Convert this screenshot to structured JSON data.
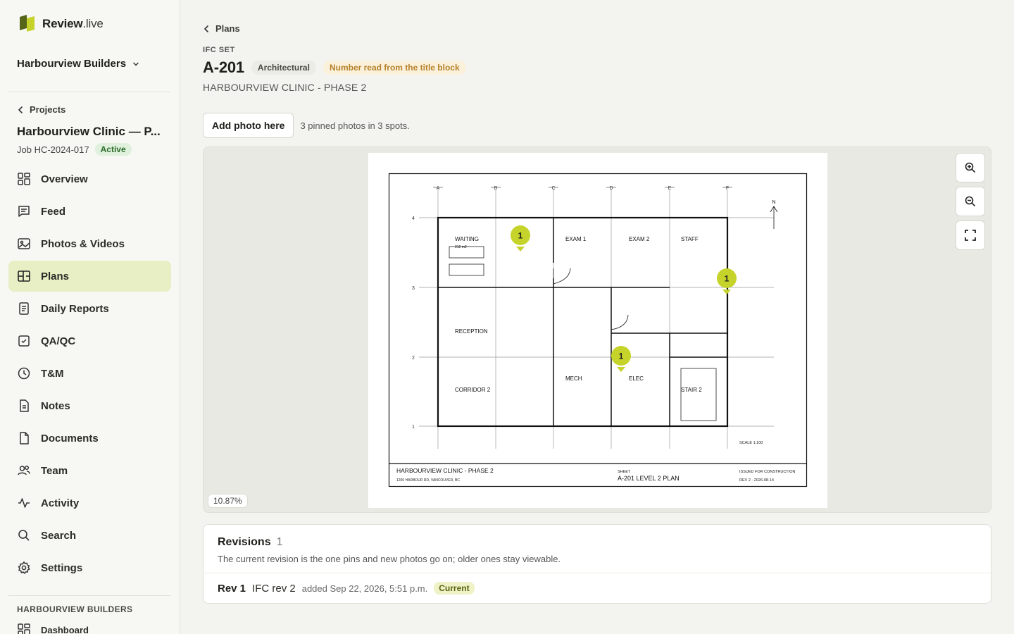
{
  "app": {
    "brand_bold": "Review",
    "brand_light": ".live"
  },
  "org": {
    "name": "Harbourview Builders"
  },
  "project": {
    "back_label": "Projects",
    "name": "Harbourview Clinic — P...",
    "job": "Job HC-2024-017",
    "status": "Active"
  },
  "nav": {
    "items": [
      {
        "label": "Overview",
        "icon": "grid-icon"
      },
      {
        "label": "Feed",
        "icon": "message-icon"
      },
      {
        "label": "Photos & Videos",
        "icon": "image-icon"
      },
      {
        "label": "Plans",
        "icon": "plan-icon",
        "active": true
      },
      {
        "label": "Daily Reports",
        "icon": "report-icon"
      },
      {
        "label": "QA/QC",
        "icon": "check-square-icon"
      },
      {
        "label": "T&M",
        "icon": "clock-icon"
      },
      {
        "label": "Notes",
        "icon": "note-icon"
      },
      {
        "label": "Documents",
        "icon": "document-icon"
      },
      {
        "label": "Team",
        "icon": "team-icon"
      },
      {
        "label": "Activity",
        "icon": "activity-icon"
      },
      {
        "label": "Search",
        "icon": "search-icon"
      },
      {
        "label": "Settings",
        "icon": "gear-icon"
      }
    ],
    "org_section": "HARBOURVIEW BUILDERS",
    "org_items": [
      {
        "label": "Dashboard",
        "icon": "grid-icon"
      }
    ]
  },
  "main": {
    "breadcrumb": "Plans",
    "set_label": "IFC SET",
    "sheet_number": "A-201",
    "discipline": "Architectural",
    "number_source": "Number read from the title block",
    "sheet_title": "HARBOURVIEW CLINIC - PHASE 2",
    "add_photo": "Add photo here",
    "pin_summary": "3 pinned photos in 3 spots.",
    "zoom_level": "10.87%"
  },
  "drawing": {
    "grid_cols": [
      "A",
      "B",
      "C",
      "D",
      "E",
      "F"
    ],
    "grid_rows": [
      "4",
      "3",
      "2",
      "1"
    ],
    "rooms": {
      "waiting": "WAITING",
      "waiting_area": "212 m2",
      "exam1": "EXAM 1",
      "exam2": "EXAM 2",
      "staff": "STAFF",
      "reception": "RECEPTION",
      "corridor": "CORRIDOR 2",
      "mech": "MECH",
      "elec": "ELEC",
      "stair": "STAIR 2"
    },
    "north": "N",
    "scale": "SCALE 1:100",
    "title_block": {
      "project": "HARBOURVIEW CLINIC - PHASE 2",
      "address": "1200 HARBOUR RD, VANCOUVER, BC",
      "sheet_label": "SHEET",
      "sheet_name": "A-201 LEVEL 2 PLAN",
      "issue": "ISSUED FOR CONSTRUCTION",
      "revision": "REV 2 · 2026-08-14"
    },
    "pins": [
      {
        "count": "1"
      },
      {
        "count": "1"
      },
      {
        "count": "1"
      }
    ]
  },
  "revisions": {
    "title": "Revisions",
    "count": "1",
    "description": "The current revision is the one pins and new photos go on; older ones stay viewable.",
    "rows": [
      {
        "rev": "Rev 1",
        "name": "IFC rev 2",
        "added": "added Sep 22, 2026, 5:51 p.m.",
        "badge": "Current"
      }
    ]
  },
  "colors": {
    "accent": "#c5d32a",
    "active_nav": "#e9efc4",
    "brand_green": "#6b7d1a"
  }
}
